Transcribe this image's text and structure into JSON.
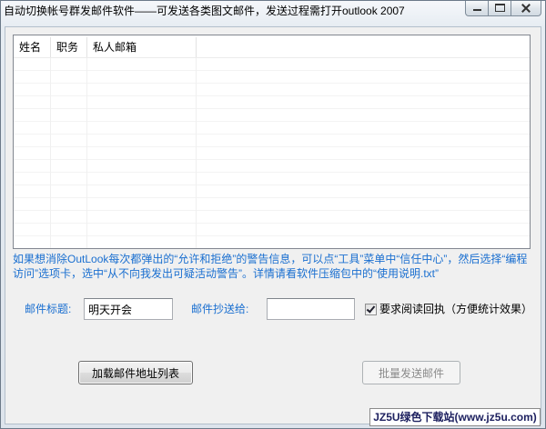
{
  "window": {
    "title": "自动切换帐号群发邮件软件——可发送各类图文邮件，发送过程需打开outlook 2007",
    "controls": {
      "minimize_icon": "minimize-icon",
      "maximize_icon": "maximize-icon",
      "close_icon": "close-icon"
    }
  },
  "list": {
    "columns": [
      "姓名",
      "职务",
      "私人邮箱"
    ]
  },
  "notice": "如果想消除OutLook每次都弹出的“允许和拒绝”的警告信息，可以点“工具”菜单中“信任中心”，然后选择“编程访问”选项卡，选中“从不向我发出可疑活动警告”。详情请看软件压缩包中的“使用说明.txt”",
  "form": {
    "subject_label": "邮件标题:",
    "subject_value": "明天开会",
    "cc_label": "邮件抄送给:",
    "cc_value": "",
    "receipt_checked": true,
    "receipt_label": "要求阅读回执（方便统计效果）"
  },
  "buttons": {
    "load_label": "加载邮件地址列表",
    "send_label": "批量发送邮件",
    "send_disabled": true
  },
  "watermark": "JZ5U绿色下载站(www.jz5u.com)",
  "colors": {
    "label_text": "#1a6fd0",
    "window_background": "#f0f0f0",
    "list_border": "#828790",
    "watermark_text": "#1e2160"
  }
}
